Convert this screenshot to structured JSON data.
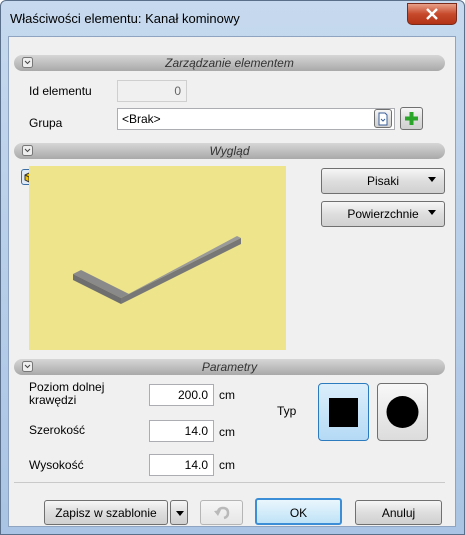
{
  "window": {
    "title": "Właściwości elementu: Kanał kominowy"
  },
  "sections": {
    "element": "Zarządzanie elementem",
    "appearance": "Wygląd",
    "params": "Parametry"
  },
  "element": {
    "id_label": "Id elementu",
    "id_value": "0",
    "group_label": "Grupa",
    "group_value": "<Brak>"
  },
  "appearance": {
    "pens_label": "Pisaki",
    "surfaces_label": "Powierzchnie"
  },
  "params": {
    "bottom_level_label": "Poziom dolnej\nkrawędzi",
    "bottom_level_value": "200.0",
    "width_label": "Szerokość",
    "width_value": "14.0",
    "height_label": "Wysokość",
    "height_value": "14.0",
    "unit": "cm",
    "type_label": "Typ"
  },
  "footer": {
    "save_template": "Zapisz w szablonie",
    "ok": "OK",
    "cancel": "Anuluj"
  }
}
